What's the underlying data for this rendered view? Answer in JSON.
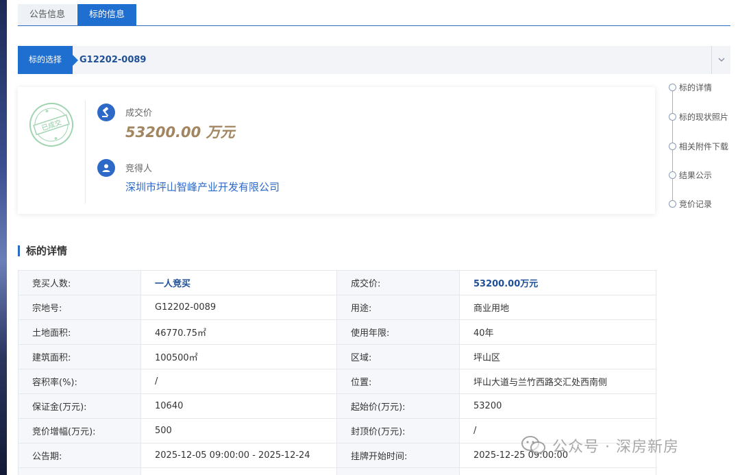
{
  "tabs": [
    {
      "label": "公告信息",
      "active": false
    },
    {
      "label": "标的信息",
      "active": true
    }
  ],
  "selector": {
    "label": "标的选择",
    "value": "G12202-0089"
  },
  "anchors": [
    "标的详情",
    "标的现状照片",
    "相关附件下载",
    "结果公示",
    "竞价记录"
  ],
  "result": {
    "seal_text": "已成交",
    "price_label": "成交价",
    "price_value": "53200.00 万元",
    "winner_label": "竞得人",
    "winner_name": "深圳市坪山智峰产业开发有限公司"
  },
  "section_title": "标的详情",
  "table_rows": [
    {
      "k1": "竞买人数:",
      "v1": "一人竞买",
      "k2": "成交价:",
      "v2": "53200.00万元"
    },
    {
      "k1": "宗地号:",
      "v1": "G12202-0089",
      "k2": "用途:",
      "v2": "商业用地"
    },
    {
      "k1": "土地面积:",
      "v1": "46770.75㎡",
      "k2": "使用年限:",
      "v2": "40年"
    },
    {
      "k1": "建筑面积:",
      "v1": "100500㎡",
      "k2": "区域:",
      "v2": "坪山区"
    },
    {
      "k1": "容积率(%):",
      "v1": "/",
      "k2": "位置:",
      "v2": "坪山大道与兰竹西路交汇处西南侧"
    },
    {
      "k1": "保证金(万元):",
      "v1": "10640",
      "k2": "起始价(万元):",
      "v2": "53200"
    },
    {
      "k1": "竞价增幅(万元):",
      "v1": "500",
      "k2": "封顶价(万元):",
      "v2": "/"
    },
    {
      "k1": "公告期:",
      "v1": "2025-12-05 09:00:00 - 2025-12-24",
      "k2": "挂牌开始时间:",
      "v2": "2025-12-25 09:00:00"
    },
    {
      "k1": "",
      "v1": "",
      "k2": "",
      "v2": ""
    }
  ],
  "watermark": "公众号 · 深房新房",
  "colors": {
    "accent": "#1f6fd1",
    "price": "#a28660",
    "link": "#2d69c7"
  }
}
